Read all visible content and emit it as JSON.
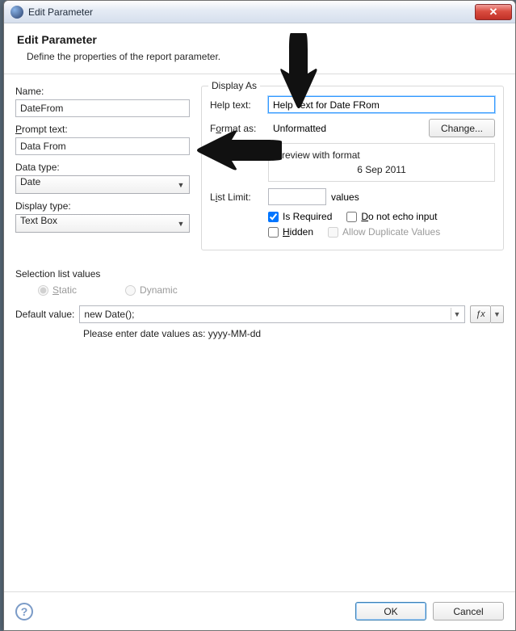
{
  "window": {
    "title": "Edit Parameter"
  },
  "header": {
    "title": "Edit Parameter",
    "subtitle": "Define the properties of the report parameter."
  },
  "left": {
    "name_label": "Name:",
    "name_value": "DateFrom",
    "prompt_label_pre": "P",
    "prompt_label_post": "rompt text:",
    "prompt_value": "Data From",
    "datatype_label": "Data type:",
    "datatype_value": "Date",
    "displaytype_label": "Display type:",
    "displaytype_value": "Text Box"
  },
  "right": {
    "group_legend": "Display As",
    "help_label": "Help text:",
    "help_value": "Help Text for Date FRom",
    "format_label_pre": "F",
    "format_label_mid": "o",
    "format_label_post": "rmat as:",
    "format_value": "Unformatted",
    "change_label": "Change...",
    "preview_label": "Preview with format",
    "preview_value": "6 Sep 2011",
    "listlimit_label_pre": "L",
    "listlimit_label_mid": "i",
    "listlimit_label_post": "st Limit:",
    "listlimit_value": "",
    "listlimit_suffix": "values",
    "is_required": "Is Required",
    "no_echo_pre": "D",
    "no_echo_post": "o not echo input",
    "hidden_pre": "H",
    "hidden_post": "idden",
    "allow_dup": "Allow Duplicate Values"
  },
  "sel_list": {
    "title": "Selection list values",
    "static_pre": "S",
    "static_post": "tatic",
    "dynamic_pre": "D",
    "dynamic_post": "ynamic"
  },
  "default": {
    "label": "Default value:",
    "value": "new Date();",
    "fx": "ƒx",
    "hint": "Please enter date values as: yyyy-MM-dd"
  },
  "footer": {
    "ok": "OK",
    "cancel": "Cancel"
  }
}
